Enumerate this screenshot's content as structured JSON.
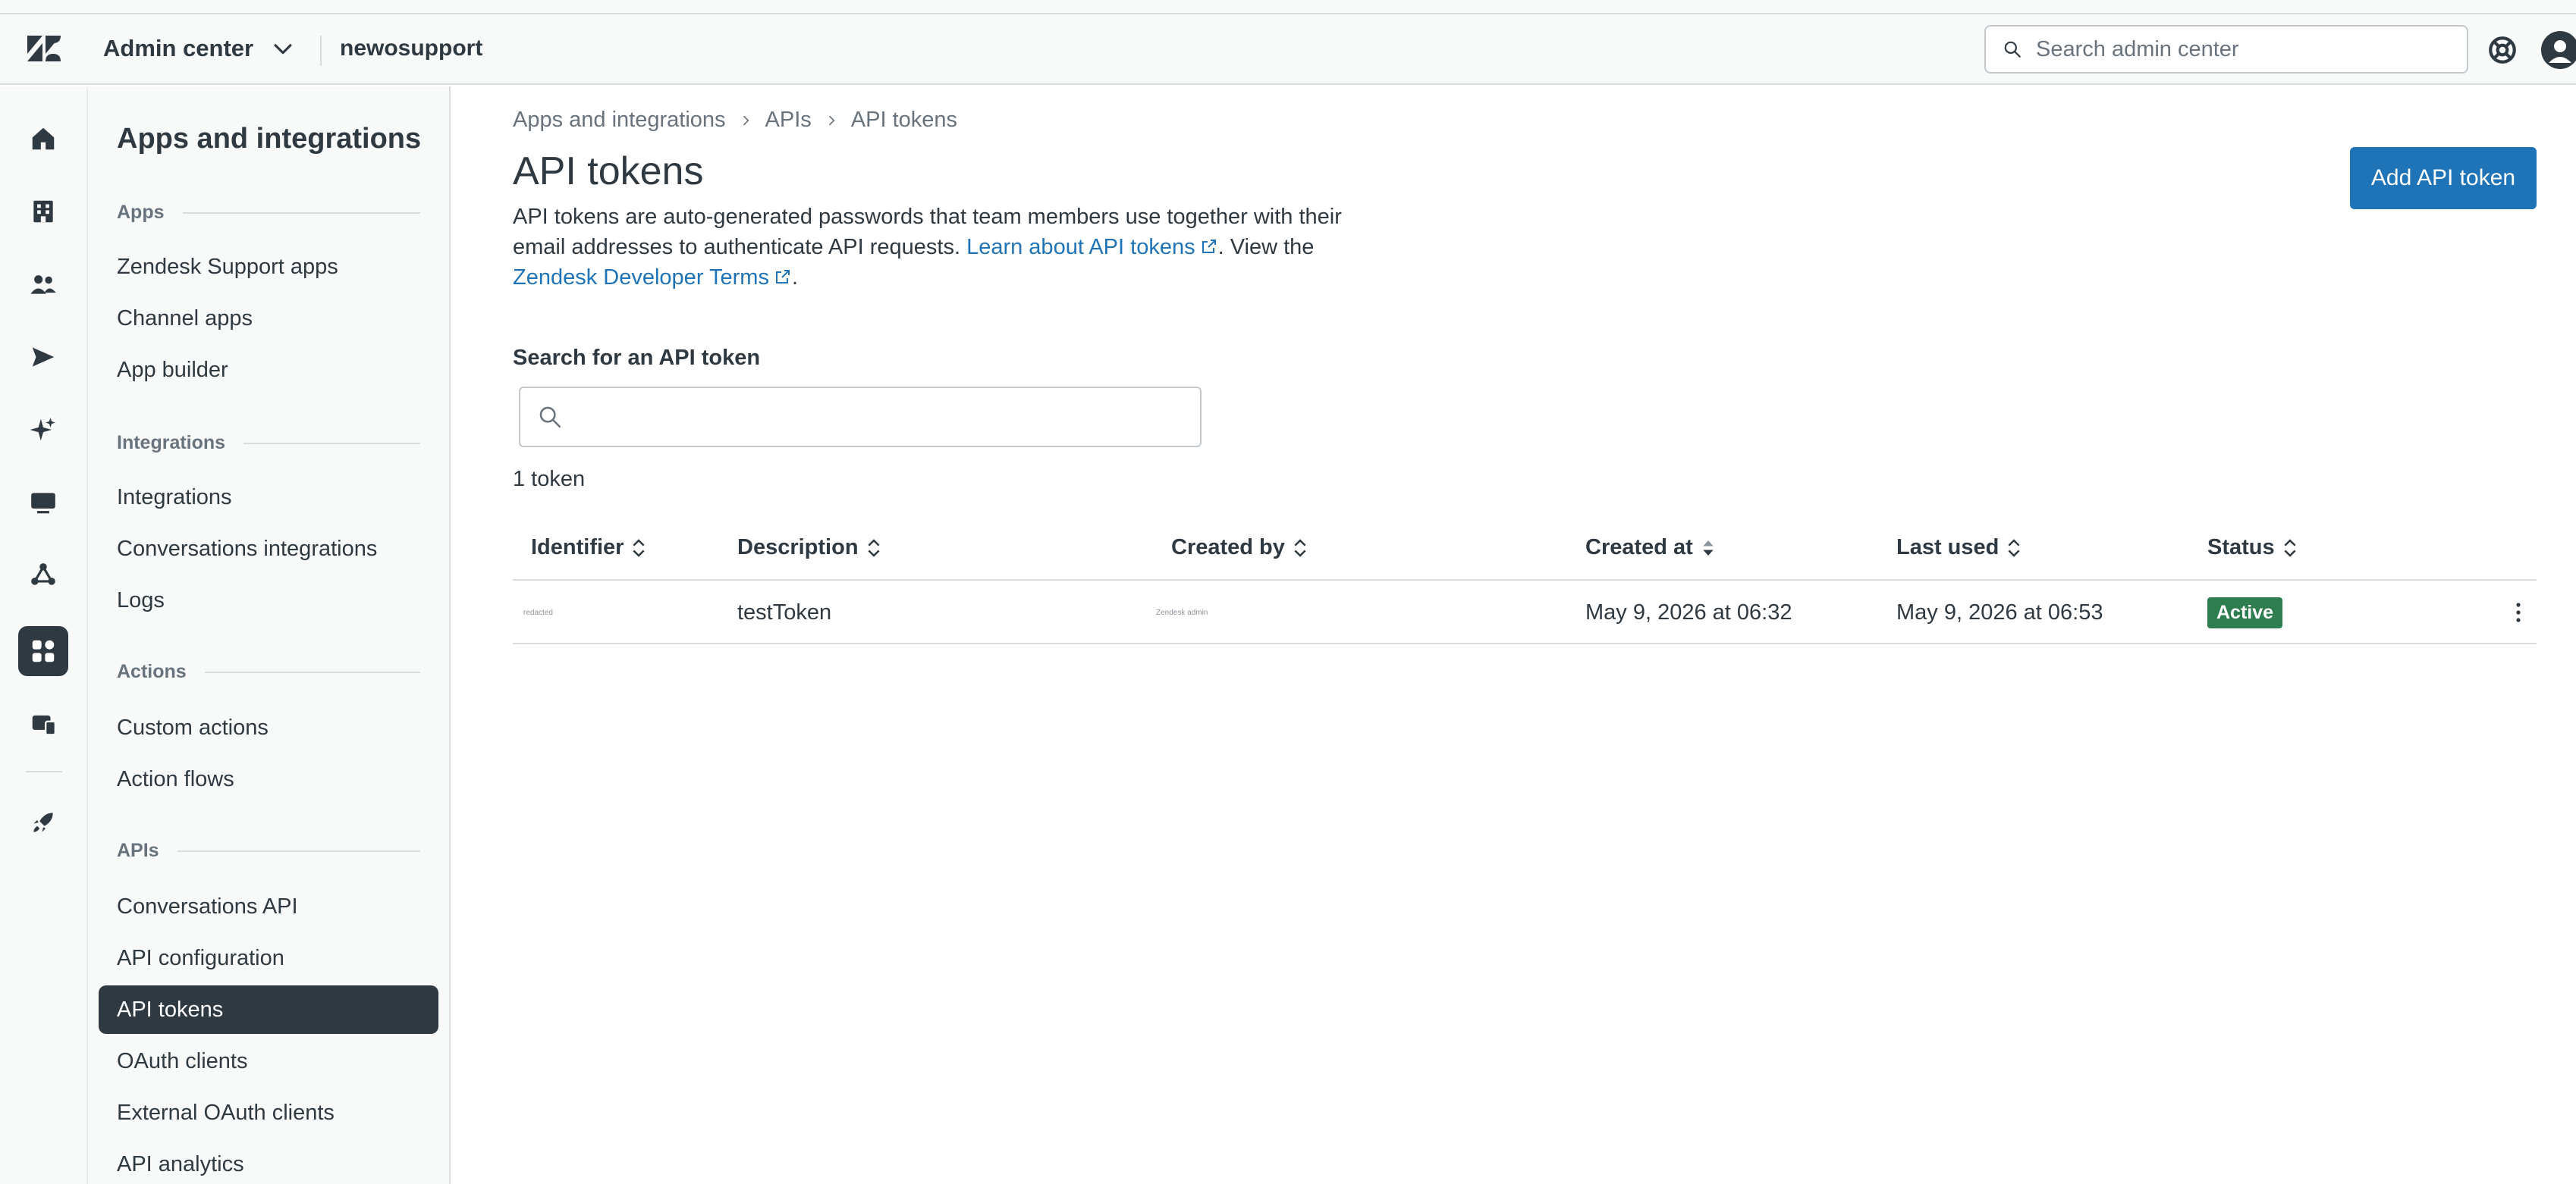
{
  "topbar": {
    "product": "Admin center",
    "account": "newosupport",
    "search_placeholder": "Search admin center"
  },
  "rail": {
    "icons": [
      "home-icon",
      "building-icon",
      "people-icon",
      "send-icon",
      "sparkle-icon",
      "monitor-icon",
      "objects-icon",
      "apps-grid-icon",
      "devices-icon",
      "rocket-icon"
    ],
    "active": "apps-grid-icon"
  },
  "subnav": {
    "title": "Apps and integrations",
    "groups": [
      {
        "label": "Apps",
        "items": [
          "Zendesk Support apps",
          "Channel apps",
          "App builder"
        ]
      },
      {
        "label": "Integrations",
        "items": [
          "Integrations",
          "Conversations integrations",
          "Logs"
        ]
      },
      {
        "label": "Actions",
        "items": [
          "Custom actions",
          "Action flows"
        ]
      },
      {
        "label": "APIs",
        "items": [
          "Conversations API",
          "API configuration",
          "API tokens",
          "OAuth clients",
          "External OAuth clients",
          "API analytics"
        ]
      }
    ],
    "active_item": "API tokens"
  },
  "breadcrumb": [
    "Apps and integrations",
    "APIs",
    "API tokens"
  ],
  "page": {
    "title": "API tokens",
    "add_button": "Add API token",
    "intro_part1": "API tokens are auto-generated passwords that team members use together with their email addresses to authenticate API requests. ",
    "intro_link1": "Learn about API tokens",
    "intro_part2": ". View the ",
    "intro_link2": "Zendesk Developer Terms",
    "intro_part3": ".",
    "search_label": "Search for an API token",
    "search_value": "",
    "count_text": "1 token"
  },
  "table": {
    "columns": [
      "Identifier",
      "Description",
      "Created by",
      "Created at",
      "Last used",
      "Status"
    ],
    "rows": [
      {
        "identifier": "redacted",
        "description": "testToken",
        "created_by": "Zendesk admin",
        "created_at": "May 9, 2026 at 06:32",
        "last_used": "May 9, 2026 at 06:53",
        "status": "Active"
      }
    ]
  },
  "colors": {
    "accent": "#1f73b7",
    "text": "#2f3941",
    "muted": "#68737d",
    "active_badge": "#2e7d4f",
    "nav_active": "#2f3941"
  }
}
